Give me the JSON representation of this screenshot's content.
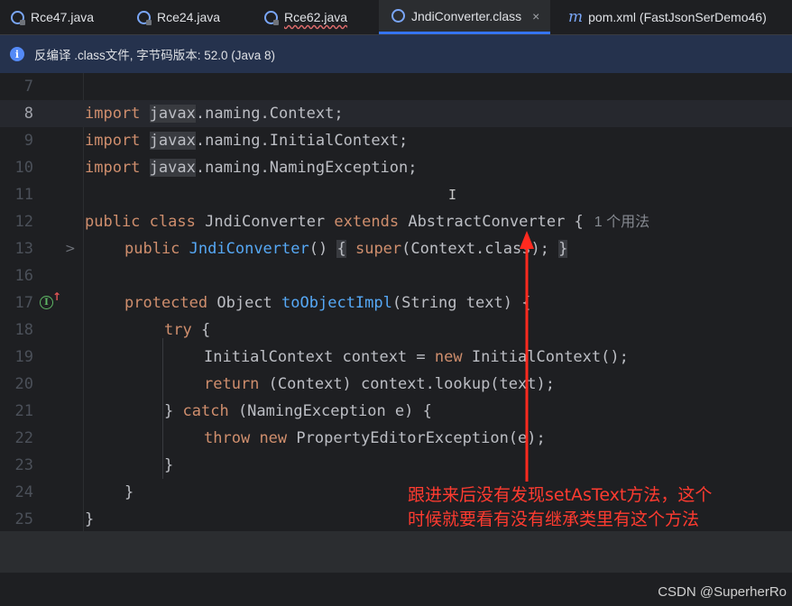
{
  "tabs": [
    {
      "label": "Rce47.java",
      "active": false
    },
    {
      "label": "Rce24.java",
      "active": false
    },
    {
      "label": "Rce62.java",
      "active": false,
      "has_error_underline": true
    },
    {
      "label": "JndiConverter.class",
      "active": true
    },
    {
      "label": "pom.xml (FastJsonSerDemo46)",
      "active": false
    }
  ],
  "tab_close": "×",
  "pom_icon": "m",
  "banner": {
    "text": "反编译 .class文件, 字节码版本: 52.0 (Java 8)",
    "icon": "info-icon"
  },
  "editor": {
    "line_numbers": [
      "7",
      "8",
      "9",
      "10",
      "11",
      "12",
      "13",
      "16",
      "17",
      "18",
      "19",
      "20",
      "21",
      "22",
      "23",
      "24",
      "25"
    ],
    "current_line": "8",
    "usage_hint": "1 个用法",
    "gutter_icon": "I",
    "gutter_arrow": "↑",
    "fold_marker": ">"
  },
  "code": {
    "l8": {
      "kw": "import",
      "pkg": "javax",
      "rest": ".naming.Context;"
    },
    "l9": {
      "kw": "import",
      "pkg": "javax",
      "rest": ".naming.InitialContext;"
    },
    "l10": {
      "kw": "import",
      "pkg": "javax",
      "rest": ".naming.NamingException;"
    },
    "l12": {
      "kw1": "public",
      "kw2": "class",
      "name": "JndiConverter",
      "kw3": "extends",
      "sup": "AbstractConverter {"
    },
    "l13": {
      "kw": "public",
      "fn": "JndiConverter",
      "paren": "()",
      "ob": "{",
      "kw2": "super",
      "args": "(Context.class);",
      "cb": "}"
    },
    "l17": {
      "kw": "protected",
      "t": "Object",
      "fn": "toObjectImpl",
      "rest": "(String text) {"
    },
    "l18": {
      "kw": "try",
      "rest": "{"
    },
    "l19": {
      "pre": "InitialContext context = ",
      "kw": "new",
      "rest": "InitialContext();"
    },
    "l20": {
      "kw": "return",
      "rest": "(Context) context.lookup(text);"
    },
    "l21": {
      "pre": "}",
      "kw": "catch",
      "rest": "(NamingException e) {"
    },
    "l22": {
      "kw1": "throw",
      "kw2": "new",
      "rest": "PropertyEditorException(e);"
    },
    "l23": {
      "text": "}"
    },
    "l24": {
      "text": "}"
    },
    "l25": {
      "text": "}"
    }
  },
  "text_cursor": "I",
  "annotation": {
    "line1": "跟进来后没有发现setAsText方法，这个",
    "line2": "时候就要看有没有继承类里有这个方法",
    "color": "#ff3b30"
  },
  "watermark": "CSDN @SuperherRo"
}
